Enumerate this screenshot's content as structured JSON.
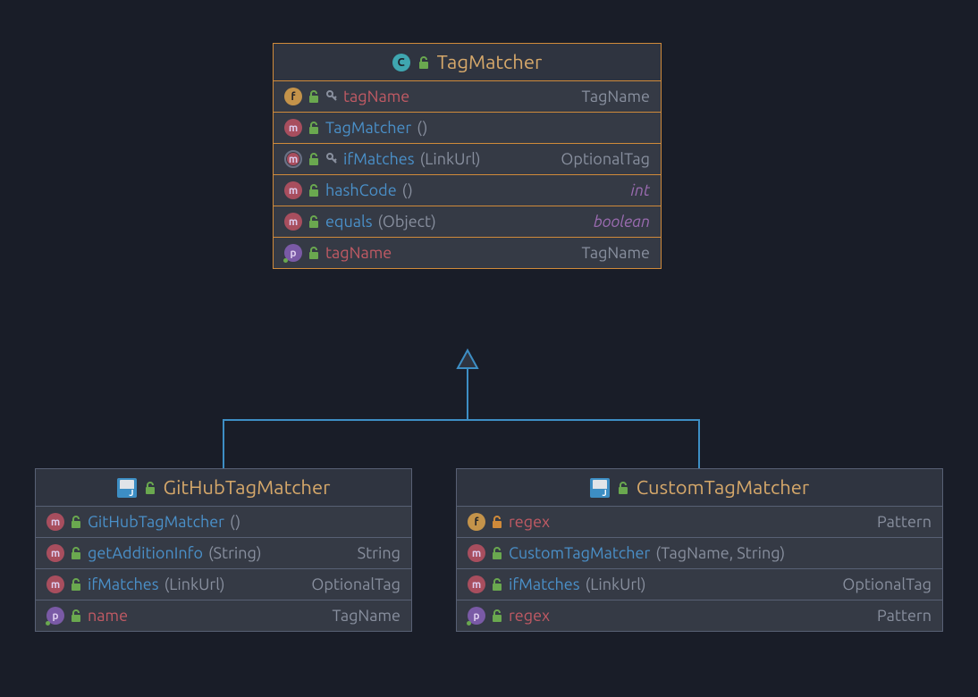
{
  "colors": {
    "bg": "#191d28",
    "box_bg": "#353a45",
    "header_bg": "#2f3440",
    "border": "#586074",
    "highlight_border": "#d08a3a",
    "title": "#d6a86a",
    "method": "#4a90c9",
    "field": "#c15a64",
    "type": "#888f9e",
    "primitive": "#9a6bb0",
    "connector": "#3d8ec4"
  },
  "parent": {
    "title": "TagMatcher",
    "rows": [
      {
        "icon": "f",
        "lock": "green",
        "key": true,
        "name": "tagName",
        "nameClass": "red",
        "params": "",
        "ret": "TagName",
        "retClass": ""
      },
      {
        "icon": "m",
        "lock": "green",
        "key": false,
        "name": "TagMatcher",
        "nameClass": "",
        "params": "()",
        "ret": "",
        "retClass": ""
      },
      {
        "icon": "m-abstract",
        "lock": "green",
        "key": true,
        "name": "ifMatches",
        "nameClass": "",
        "params": "(LinkUrl)",
        "ret": "OptionalTag",
        "retClass": ""
      },
      {
        "icon": "m",
        "lock": "green",
        "key": false,
        "name": "hashCode",
        "nameClass": "",
        "params": "()",
        "ret": "int",
        "retClass": "primitive"
      },
      {
        "icon": "m",
        "lock": "green",
        "key": false,
        "name": "equals",
        "nameClass": "",
        "params": "(Object)",
        "ret": "boolean",
        "retClass": "primitive"
      },
      {
        "icon": "p",
        "lock": "green",
        "key": false,
        "name": "tagName",
        "nameClass": "red",
        "params": "",
        "ret": "TagName",
        "retClass": ""
      }
    ]
  },
  "children": [
    {
      "title": "GitHubTagMatcher",
      "rows": [
        {
          "icon": "m",
          "lock": "green",
          "key": false,
          "name": "GitHubTagMatcher",
          "nameClass": "",
          "params": "()",
          "ret": "",
          "retClass": ""
        },
        {
          "icon": "m",
          "lock": "green",
          "key": false,
          "name": "getAdditionInfo",
          "nameClass": "",
          "params": "(String)",
          "ret": "String",
          "retClass": ""
        },
        {
          "icon": "m",
          "lock": "green",
          "key": false,
          "name": "ifMatches",
          "nameClass": "",
          "params": "(LinkUrl)",
          "ret": "OptionalTag",
          "retClass": ""
        },
        {
          "icon": "p",
          "lock": "green",
          "key": false,
          "name": "name",
          "nameClass": "red",
          "params": "",
          "ret": "TagName",
          "retClass": ""
        }
      ]
    },
    {
      "title": "CustomTagMatcher",
      "rows": [
        {
          "icon": "f",
          "lock": "orange",
          "key": false,
          "name": "regex",
          "nameClass": "red",
          "params": "",
          "ret": "Pattern",
          "retClass": ""
        },
        {
          "icon": "m",
          "lock": "green",
          "key": false,
          "name": "CustomTagMatcher",
          "nameClass": "",
          "params": "(TagName, String)",
          "ret": "",
          "retClass": ""
        },
        {
          "icon": "m",
          "lock": "green",
          "key": false,
          "name": "ifMatches",
          "nameClass": "",
          "params": "(LinkUrl)",
          "ret": "OptionalTag",
          "retClass": ""
        },
        {
          "icon": "p",
          "lock": "green",
          "key": false,
          "name": "regex",
          "nameClass": "red",
          "params": "",
          "ret": "Pattern",
          "retClass": ""
        }
      ]
    }
  ]
}
